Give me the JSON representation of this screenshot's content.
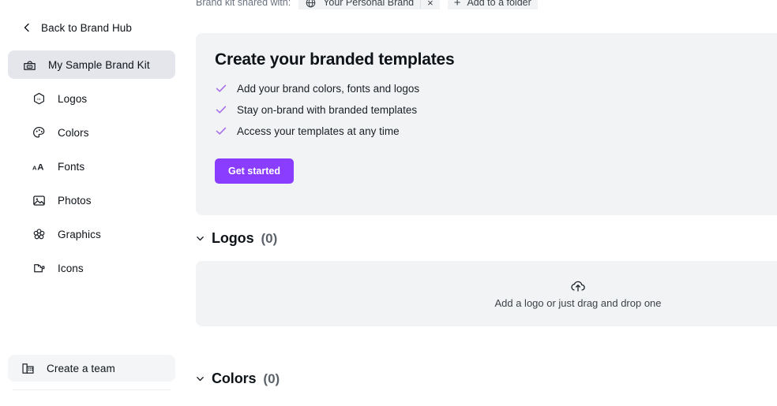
{
  "sidebar": {
    "back": {
      "label": "Back to Brand Hub",
      "icon": "chevron-left-icon"
    },
    "kit": {
      "label": "My Sample Brand Kit",
      "icon": "brand-kit-icon",
      "selected": true
    },
    "items": [
      {
        "label": "Logos",
        "icon": "logo-hexagon-icon"
      },
      {
        "label": "Colors",
        "icon": "palette-icon"
      },
      {
        "label": "Fonts",
        "icon": "font-aa-icon"
      },
      {
        "label": "Photos",
        "icon": "photo-icon"
      },
      {
        "label": "Graphics",
        "icon": "graphics-flower-icon"
      },
      {
        "label": "Icons",
        "icon": "icons-puzzle-icon"
      }
    ],
    "team": {
      "label": "Create a team",
      "icon": "building-icon"
    }
  },
  "sharebar": {
    "label": "Brand kit shared with:",
    "chip": {
      "label": "Your Personal Brand",
      "icon": "globe-icon",
      "close": "×"
    },
    "add_folder": {
      "label": "Add to a folder",
      "icon": "plus-icon"
    }
  },
  "promo": {
    "title": "Create your branded templates",
    "bullets": [
      "Add your brand colors, fonts and logos",
      "Stay on-brand with branded templates",
      "Access your templates at any time"
    ],
    "cta_label": "Get started",
    "accent_color": "#8B3DFF",
    "check_color": "#A86FE8"
  },
  "sections": [
    {
      "id": "logos",
      "title": "Logos",
      "count": "(0)",
      "chevron": "chevron-down-icon",
      "dropzone": {
        "text": "Add a logo or just drag and drop one",
        "icon": "cloud-upload-icon"
      }
    },
    {
      "id": "colors",
      "title": "Colors",
      "count": "(0)",
      "chevron": "chevron-down-icon"
    }
  ]
}
